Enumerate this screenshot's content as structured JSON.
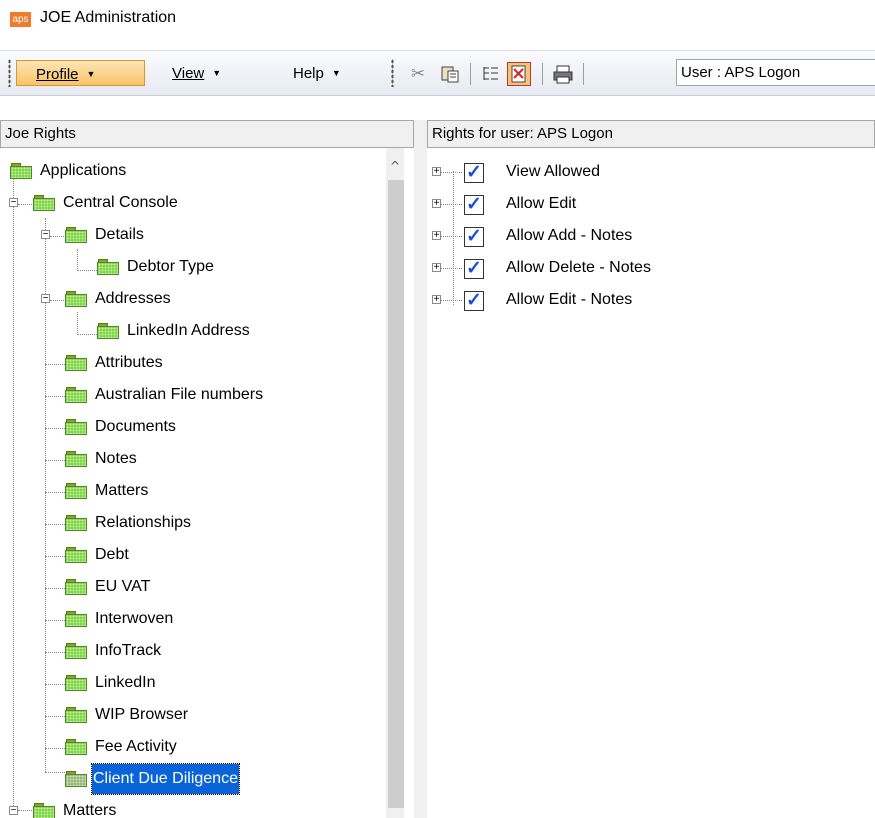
{
  "window": {
    "logo_text": "aps",
    "title": "JOE Administration"
  },
  "toolbar": {
    "menus": [
      {
        "label": "Profile"
      },
      {
        "label": "View"
      },
      {
        "label": "Help"
      }
    ],
    "icons": [
      "cut-icon",
      "paste-icon",
      "tree-view-icon",
      "rights-report-icon",
      "print-icon"
    ],
    "user_field": "User : APS Logon"
  },
  "left_panel": {
    "header": "Joe Rights",
    "tree": [
      {
        "label": "Applications"
      },
      {
        "label": "Central Console"
      },
      {
        "label": "Details"
      },
      {
        "label": "Debtor Type"
      },
      {
        "label": "Addresses"
      },
      {
        "label": "LinkedIn Address"
      },
      {
        "label": "Attributes"
      },
      {
        "label": "Australian File numbers"
      },
      {
        "label": "Documents"
      },
      {
        "label": "Notes"
      },
      {
        "label": "Matters"
      },
      {
        "label": "Relationships"
      },
      {
        "label": "Debt"
      },
      {
        "label": "EU VAT"
      },
      {
        "label": "Interwoven"
      },
      {
        "label": "InfoTrack"
      },
      {
        "label": "LinkedIn"
      },
      {
        "label": "WIP Browser"
      },
      {
        "label": "Fee Activity"
      },
      {
        "label": "Client Due Diligence",
        "selected": true
      },
      {
        "label": "Matters"
      }
    ]
  },
  "right_panel": {
    "header": "Rights for user: APS Logon",
    "rights": [
      {
        "label": "View Allowed",
        "checked": true
      },
      {
        "label": "Allow Edit",
        "checked": true
      },
      {
        "label": "Allow Add - Notes",
        "checked": true
      },
      {
        "label": "Allow Delete - Notes",
        "checked": true
      },
      {
        "label": "Allow Edit - Notes",
        "checked": true
      }
    ]
  },
  "colors": {
    "selection": "#0a64d8",
    "folder": "#79d045",
    "check": "#1a4fd6",
    "profile_button": "#f9c46a"
  }
}
